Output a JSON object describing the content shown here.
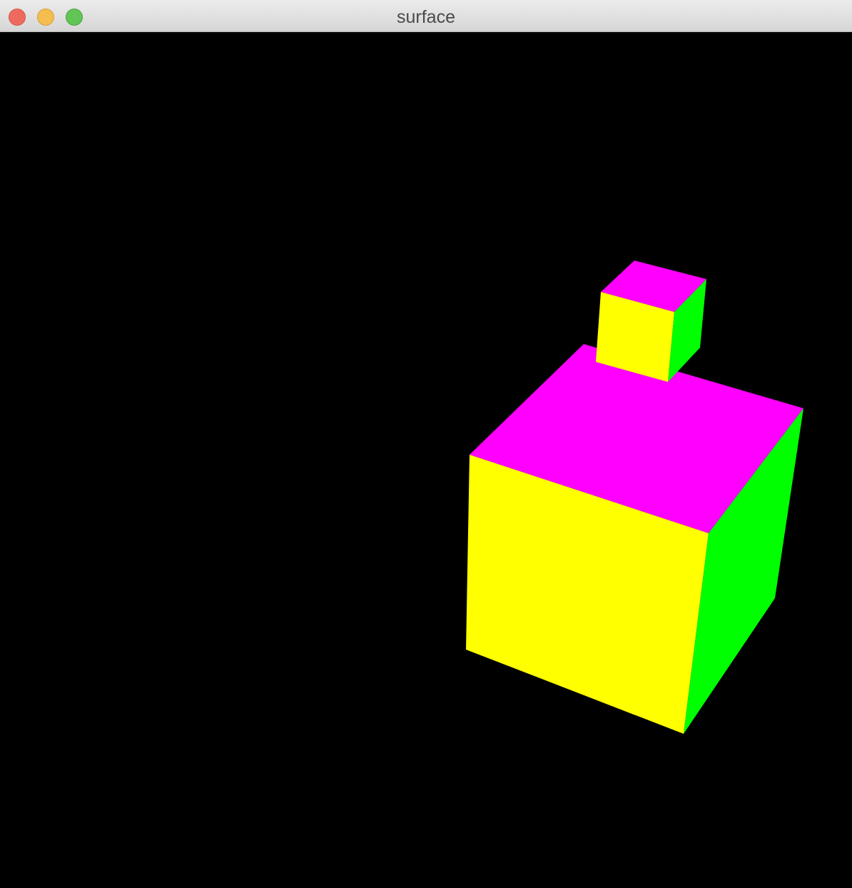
{
  "window": {
    "title": "surface",
    "buttons": {
      "close": "close-button",
      "minimize": "minimize-button",
      "zoom": "zoom-button"
    }
  },
  "scene": {
    "background": "#000000",
    "face_colors": {
      "top": "#ff00ff",
      "front": "#ffff00",
      "side": "#00ff00"
    },
    "objects": [
      "large-cube",
      "small-cube"
    ]
  }
}
